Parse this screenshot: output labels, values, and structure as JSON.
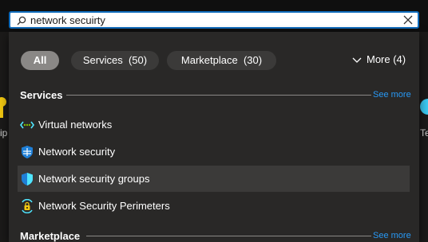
{
  "search": {
    "value": "network secuirty",
    "placeholder": ""
  },
  "filters": {
    "all_label": "All",
    "services_label": "Services  (50)",
    "marketplace_label": "Marketplace  (30)",
    "more_label": "More (4)"
  },
  "services": {
    "heading": "Services",
    "see_more": "See more",
    "items": [
      {
        "label": "Virtual networks",
        "icon": "virtual-networks-icon"
      },
      {
        "label": "Network security",
        "icon": "network-security-icon"
      },
      {
        "label": "Network security groups",
        "icon": "network-security-groups-icon"
      },
      {
        "label": "Network Security Perimeters",
        "icon": "network-security-perimeters-icon"
      }
    ]
  },
  "marketplace": {
    "heading": "Marketplace",
    "see_more": "See more"
  },
  "background": {
    "left_text": "ip",
    "right_text": "Te"
  },
  "colors": {
    "accent": "#0f6cbd",
    "link": "#2899f5",
    "panel": "#292827",
    "active_pill": "#8a8886"
  }
}
